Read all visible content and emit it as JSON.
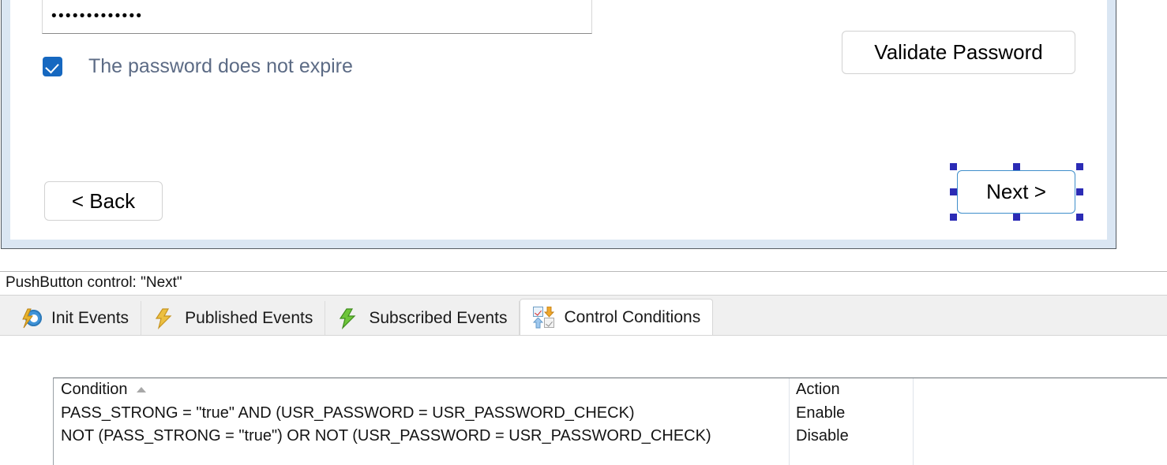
{
  "preview": {
    "password_field": {
      "name": "password-input",
      "masked_value": "•••••••••••••",
      "placeholder": ""
    },
    "checkbox": {
      "label": "The password does not expire",
      "checked": true,
      "accent_color": "#1668c0"
    },
    "buttons": {
      "validate": "Validate Password",
      "back": "< Back",
      "next": "Next >"
    },
    "selection": {
      "selected_control": "Next >",
      "handle_color": "#2b2bb5",
      "outline_color": "#3f8ecb"
    }
  },
  "status": {
    "text": "PushButton control: \"Next\""
  },
  "tabs": {
    "active_index": 3,
    "items": [
      {
        "label": "Init Events",
        "icon": "bolt-gear-icon",
        "active": false
      },
      {
        "label": "Published Events",
        "icon": "yellow-bolt-icon",
        "active": false
      },
      {
        "label": "Subscribed Events",
        "icon": "green-bolt-icon",
        "active": false
      },
      {
        "label": "Control Conditions",
        "icon": "control-conditions-icon",
        "active": true
      }
    ]
  },
  "grid": {
    "columns": [
      "Condition",
      "Action"
    ],
    "sort_column": "Condition",
    "sort_direction": "ascending",
    "rows": [
      {
        "condition": "PASS_STRONG = \"true\" AND (USR_PASSWORD = USR_PASSWORD_CHECK)",
        "action": "Enable"
      },
      {
        "condition": "NOT (PASS_STRONG = \"true\") OR NOT (USR_PASSWORD = USR_PASSWORD_CHECK)",
        "action": "Disable"
      }
    ]
  }
}
